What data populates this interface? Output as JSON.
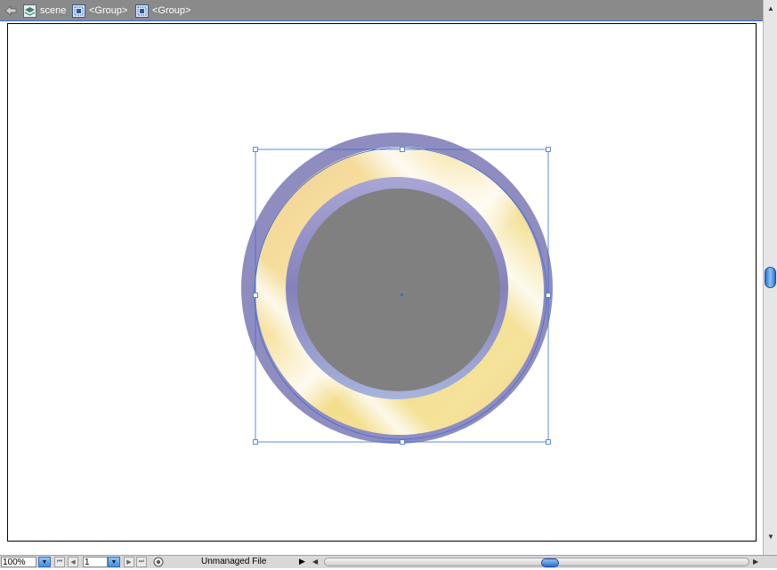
{
  "breadcrumb": {
    "items": [
      {
        "label": "scene",
        "icon": "layer-stack-icon"
      },
      {
        "label": "<Group>",
        "icon": "group-icon"
      },
      {
        "label": "<Group>",
        "icon": "group-icon"
      }
    ]
  },
  "status": {
    "zoom": "100%",
    "page": "1",
    "file_status": "Unmanaged File"
  },
  "colors": {
    "toolbar": "#8a8a8a",
    "selection": "#3b6fd6",
    "ring_outer": "#8f8cc0",
    "ring_gold": "#f3dc90",
    "center": "#808080"
  }
}
